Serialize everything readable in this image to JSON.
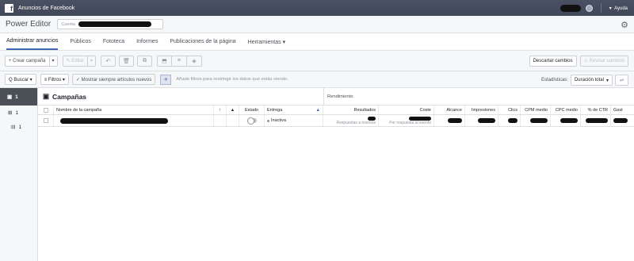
{
  "app": {
    "title": "Anuncios de Facebook",
    "help": "Ayuda"
  },
  "header": {
    "title": "Power Editor",
    "account_label": "Cuenta"
  },
  "nav": {
    "items": [
      {
        "label": "Administrar anuncios"
      },
      {
        "label": "Públicos"
      },
      {
        "label": "Fototeca"
      },
      {
        "label": "Informes"
      },
      {
        "label": "Publicaciones de la página"
      },
      {
        "label": "Herramientas ▾"
      }
    ]
  },
  "toolbar": {
    "create": "+ Crear campaña",
    "create_caret": "▾",
    "edit": "✎ Editar",
    "edit_caret": "▾",
    "discard": "Descartar cambios",
    "review": "⚠ Revisar cambios"
  },
  "filterbar": {
    "search": "Q Buscar ▾",
    "filters": "≡ Filtros ▾",
    "show_new": "✓ Mostrar siempre artículos nuevos",
    "hint": "Añade filtros para restringir los datos que estás viendo.",
    "stats_label": "Estadísticas:",
    "stats_value": "Duración total",
    "stats_caret": "▾"
  },
  "sidebar": {
    "items": [
      {
        "label": "1"
      },
      {
        "label": "1"
      },
      {
        "label": "1"
      }
    ]
  },
  "table": {
    "section_title": "Campañas",
    "performance_title": "Rendimiento",
    "columns": {
      "name": "Nombre de la campaña",
      "status": "Estado",
      "delivery": "Entrega",
      "results": "Resultados",
      "cost": "Coste",
      "reach": "Alcance",
      "impressions": "Impresiones",
      "clicks": "Clics",
      "cpm": "CPM medio",
      "cpc": "CPC medio",
      "ctr": "% de CTR",
      "spend": "Gast"
    },
    "rows": [
      {
        "delivery": "Inactiva",
        "results_sub": "Respuestas a eventos",
        "cost_sub": "Por respuesta al evento"
      }
    ]
  },
  "colors": {
    "topbar": "#4a5163",
    "accent": "#4267b2",
    "background": "#e9ebee"
  }
}
